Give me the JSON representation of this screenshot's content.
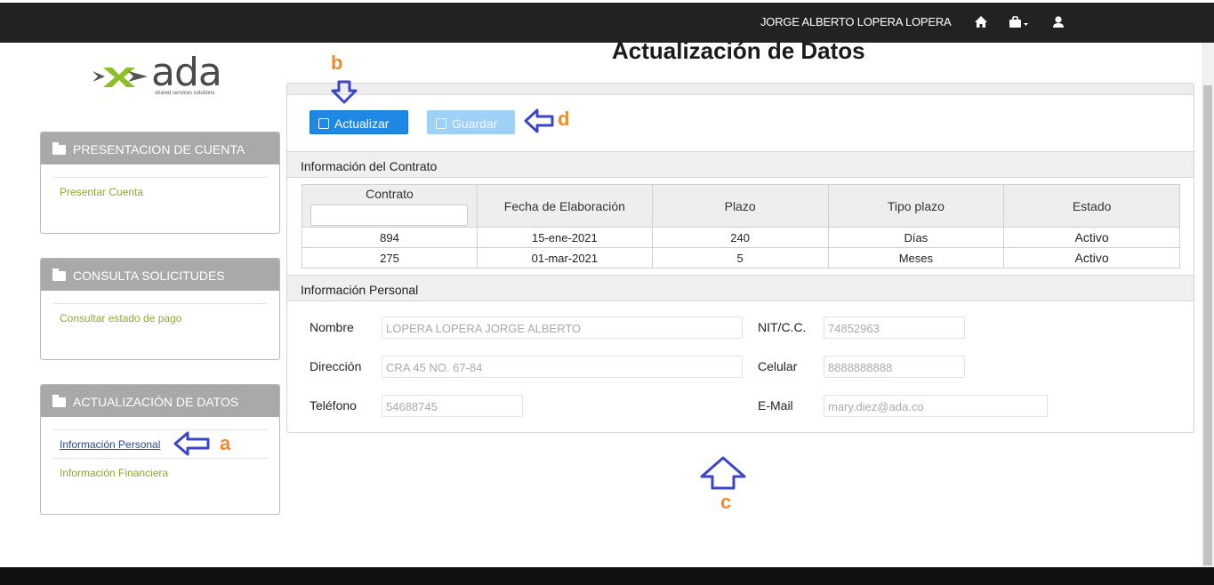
{
  "navbar": {
    "user_name": "JORGE ALBERTO LOPERA LOPERA",
    "icons": [
      "home-icon",
      "briefcase-icon",
      "user-icon"
    ]
  },
  "logo": {
    "word": "ada",
    "tagline": "shared services solutions"
  },
  "sidebar": {
    "panels": [
      {
        "title": "PRESENTACION DE CUENTA",
        "links": [
          "Presentar Cuenta"
        ]
      },
      {
        "title": "CONSULTA SOLICITUDES",
        "links": [
          "Consultar estado de pago"
        ]
      },
      {
        "title": "ACTUALIZACIÓN DE DATOS",
        "links": [
          "Información Personal",
          "Información Financiera"
        ]
      }
    ]
  },
  "page": {
    "title": "Actualización de Datos"
  },
  "toolbar": {
    "update_label": "Actualizar",
    "save_label": "Guardar"
  },
  "contract": {
    "section_title": "Información del Contrato",
    "headers": [
      "Contrato",
      "Fecha de Elaboración",
      "Plazo",
      "Tipo plazo",
      "Estado"
    ],
    "filter_value": "",
    "rows": [
      [
        "894",
        "15-ene-2021",
        "240",
        "Días",
        "Activo"
      ],
      [
        "275",
        "01-mar-2021",
        "5",
        "Meses",
        "Activo"
      ]
    ]
  },
  "personal": {
    "section_title": "Información Personal",
    "labels": {
      "name": "Nombre",
      "nit": "NIT/C.C.",
      "address": "Dirección",
      "mobile": "Celular",
      "phone": "Teléfono",
      "email": "E-Mail"
    },
    "values": {
      "name": "LOPERA LOPERA JORGE ALBERTO",
      "nit": "74852963",
      "address": "CRA 45 NO. 67-84",
      "mobile": "8888888888",
      "phone": "54688745",
      "email": "mary.diez@ada.co"
    }
  },
  "annotations": {
    "a": "a",
    "b": "b",
    "c": "c",
    "d": "d"
  },
  "colors": {
    "annotation_letter": "#f08a2c",
    "annotation_arrow": "#3b45c9",
    "primary_button": "#1e88e5",
    "link": "#8ea63a"
  }
}
